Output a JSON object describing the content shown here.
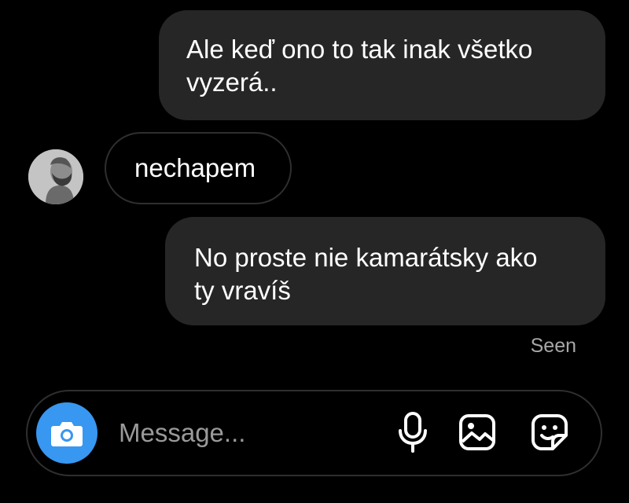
{
  "messages": [
    {
      "direction": "outgoing",
      "text_line1": "Ale keď ono to tak inak všetko",
      "text_line2": "vyzerá.."
    },
    {
      "direction": "incoming",
      "text": "nechapem"
    },
    {
      "direction": "outgoing",
      "text_line1": "No proste nie kamarátsky ako",
      "text_line2": "ty vravíš"
    }
  ],
  "status": {
    "seen": "Seen"
  },
  "composer": {
    "placeholder": "Message...",
    "icons": [
      "camera-icon",
      "microphone-icon",
      "gallery-icon",
      "sticker-icon"
    ],
    "accent": "#3897f0"
  },
  "theme": {
    "background": "#000000",
    "bubble": "#262626",
    "muted_text": "#a8a8a8"
  }
}
